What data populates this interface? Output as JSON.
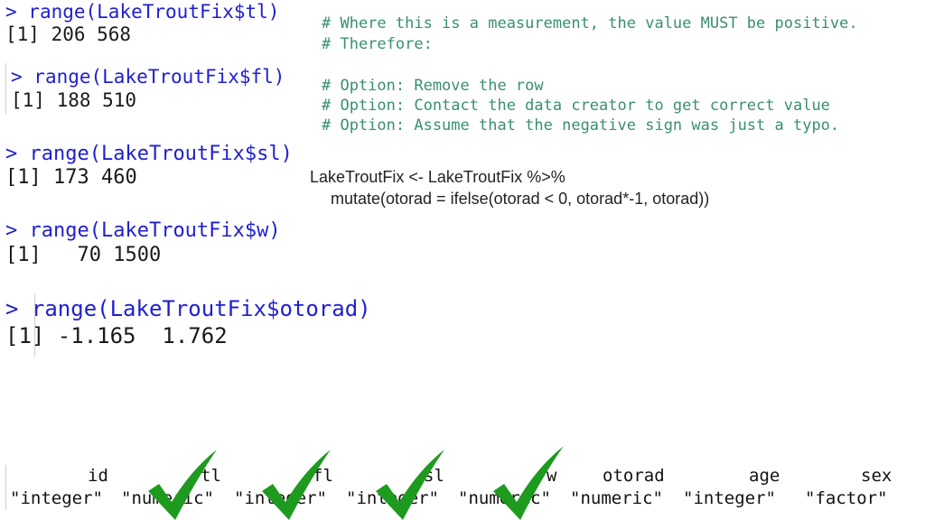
{
  "console": {
    "blocks": [
      {
        "prompt": "> ",
        "command": "range(LakeTroutFix$tl)",
        "result": "[1] 206 568"
      },
      {
        "prompt": "> ",
        "command": "range(LakeTroutFix$fl)",
        "result": "[1] 188 510"
      },
      {
        "prompt": "> ",
        "command": "range(LakeTroutFix$sl)",
        "result": "[1] 173 460"
      },
      {
        "prompt": "> ",
        "command": "range(LakeTroutFix$w)",
        "result": "[1]   70 1500"
      },
      {
        "prompt": "> ",
        "command": "range(LakeTroutFix$otorad)",
        "result": "[1] -1.165  1.762"
      }
    ]
  },
  "comments": {
    "line1": "# Where this is a measurement, the value MUST be positive.",
    "line2": "# Therefore:",
    "option1": "# Option: Remove the row",
    "option2": "# Option: Contact the data creator to get correct value",
    "option3": "# Option: Assume that the negative sign was just a typo."
  },
  "code": {
    "line1": "LakeTroutFix <- LakeTroutFix %>%",
    "line2": "mutate(otorad = ifelse(otorad < 0, otorad*-1, otorad))"
  },
  "types": {
    "names": [
      "id",
      "tl",
      "fl",
      "sl",
      "w",
      "otorad",
      "age",
      "sex"
    ],
    "classes": [
      "\"integer\"",
      "\"numeric\"",
      "\"integer\"",
      "\"integer\"",
      "\"numeric\"",
      "\"numeric\"",
      "\"integer\"",
      "\"factor\""
    ]
  },
  "colors": {
    "command": "#1f1fcf",
    "comment": "#3a8f6f",
    "check": "#1e9a1e"
  },
  "icons": {
    "check": "checkmark-icon"
  }
}
